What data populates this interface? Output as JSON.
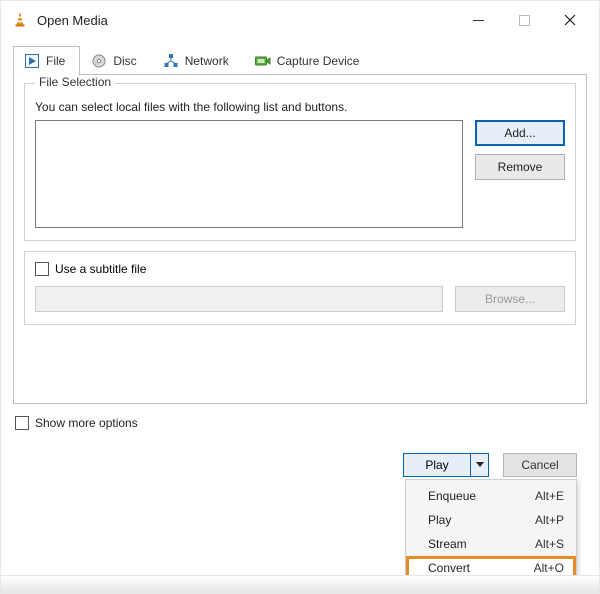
{
  "window": {
    "title": "Open Media"
  },
  "tabs": [
    {
      "label": "File"
    },
    {
      "label": "Disc"
    },
    {
      "label": "Network"
    },
    {
      "label": "Capture Device"
    }
  ],
  "file_selection": {
    "legend": "File Selection",
    "hint": "You can select local files with the following list and buttons.",
    "add_label": "Add...",
    "remove_label": "Remove"
  },
  "subtitle": {
    "checkbox_label": "Use a subtitle file",
    "browse_label": "Browse..."
  },
  "show_more_label": "Show more options",
  "bottom": {
    "play_label": "Play",
    "cancel_label": "Cancel"
  },
  "menu": {
    "items": [
      {
        "label": "Enqueue",
        "shortcut": "Alt+E"
      },
      {
        "label": "Play",
        "shortcut": "Alt+P"
      },
      {
        "label": "Stream",
        "shortcut": "Alt+S"
      },
      {
        "label": "Convert",
        "shortcut": "Alt+O"
      }
    ]
  }
}
